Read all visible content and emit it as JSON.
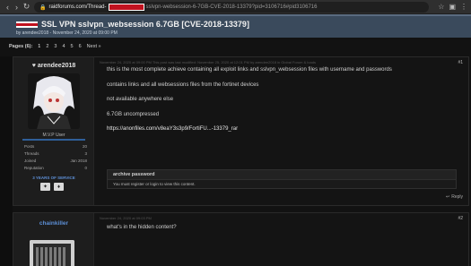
{
  "browser": {
    "url_host": "raidforums.com/Thread-",
    "url_rest": "sslvpn-websession-6-7GB-CVE-2018-13379?pid=3106716#pid3106716"
  },
  "thread": {
    "title": "SSL VPN sslvpn_websession 6.7GB [CVE-2018-13379]",
    "subtitle": "by arendee2018 - November 24, 2020 at 09:00 PM"
  },
  "pagination": {
    "label": "Pages (6):",
    "pages": [
      "1",
      "2",
      "3",
      "4",
      "5",
      "6"
    ],
    "next": "Next »"
  },
  "post1": {
    "author": "arendee2018",
    "rank": "M.V.P User",
    "stats": [
      {
        "k": "Posts",
        "v": "20"
      },
      {
        "k": "Threads",
        "v": "3"
      },
      {
        "k": "Joined",
        "v": "Jan 2018"
      },
      {
        "k": "Reputation",
        "v": "0"
      }
    ],
    "service": "3 YEARS OF SERVICE",
    "meta": "November 24, 2020 at 09:00 PM  This post was last modified: November 25, 2020 at 12:01 PM by arendee2018 in Global Forum & loads",
    "number": "#1",
    "lines": [
      "this is the most complete achieve containing all exploit links and sslvpn_websession files with username and passwords",
      "contains links and all websessions files from the fortinet devices",
      "not available anywhere else",
      "6.7GB uncompressed",
      "https://anonfiles.com/v8eaY3s3p9/FortiFU...-13379_rar"
    ],
    "hidden_title": "archive password",
    "hidden_msg": "You must register or login to view this content.",
    "reply": "Reply"
  },
  "post2": {
    "author": "chainkiller",
    "meta": "November 24, 2020 at 09:03 PM",
    "number": "#2",
    "text": "what's in the hidden content?"
  }
}
